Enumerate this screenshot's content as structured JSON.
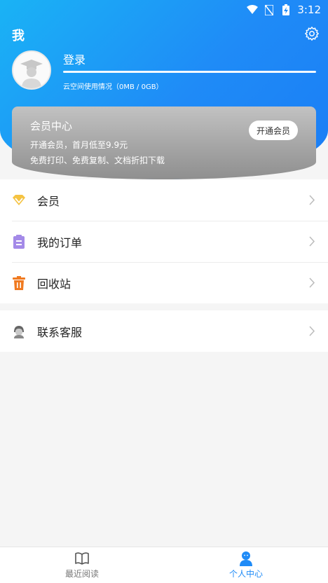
{
  "status_bar": {
    "time": "3:12"
  },
  "header": {
    "title": "我",
    "login_label": "登录",
    "storage_text": "云空间使用情况（0MB / 0GB）",
    "storage_usage": 0
  },
  "vip_card": {
    "title": "会员中心",
    "line1": "开通会员，首月低至9.9元",
    "line2": "免费打印、免费复制、文档折扣下载",
    "open_button": "开通会员"
  },
  "menu": {
    "group1": [
      {
        "label": "会员",
        "icon": "diamond-icon"
      },
      {
        "label": "我的订单",
        "icon": "clipboard-icon"
      },
      {
        "label": "回收站",
        "icon": "trash-icon"
      }
    ],
    "group2": [
      {
        "label": "联系客服",
        "icon": "customer-service-icon"
      }
    ]
  },
  "tabs": [
    {
      "label": "最近阅读",
      "icon": "book-icon",
      "active": false
    },
    {
      "label": "个人中心",
      "icon": "person-icon",
      "active": true
    }
  ],
  "colors": {
    "accent": "#1f8bf7",
    "vip_gold": "#f5c342",
    "order_purple": "#a48ae8",
    "trash_orange": "#f07a20"
  }
}
